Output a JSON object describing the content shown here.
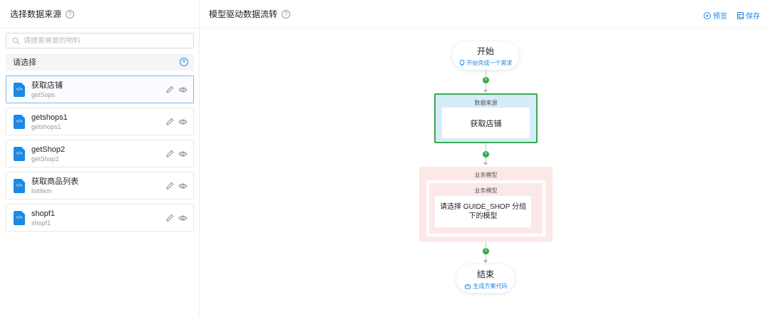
{
  "left": {
    "title": "选择数据来源",
    "help": "?",
    "search_placeholder": "请搜索需要的物料",
    "select_label": "请选择",
    "add_symbol": "+",
    "items": [
      {
        "name": "获取店铺",
        "sub": "getSops"
      },
      {
        "name": "getshops1",
        "sub": "getshops1"
      },
      {
        "name": "getShop2",
        "sub": "getShop2"
      },
      {
        "name": "获取商品列表",
        "sub": "listItem"
      },
      {
        "name": "shopf1",
        "sub": "shopf1"
      }
    ],
    "file_icon_glyph": "</>"
  },
  "right": {
    "title": "模型驱动数据流转",
    "help": "?",
    "actions": {
      "preview": "预览",
      "save": "保存"
    },
    "start": {
      "title": "开始",
      "sub": "开始完成一个需求"
    },
    "source": {
      "label": "数据来源",
      "content": "获取店铺"
    },
    "model": {
      "outer_label": "业务模型",
      "inner_label": "业务模型",
      "content": "请选择 GUIDE_SHOP 分组下的模型"
    },
    "end": {
      "title": "结束",
      "sub": "生成方案代码"
    },
    "connector_glyph": "≡"
  },
  "colors": {
    "accent": "#1e88e5",
    "green": "#3aa94e",
    "source_bg": "#d6ecf9",
    "model_bg": "#fde8e8"
  }
}
